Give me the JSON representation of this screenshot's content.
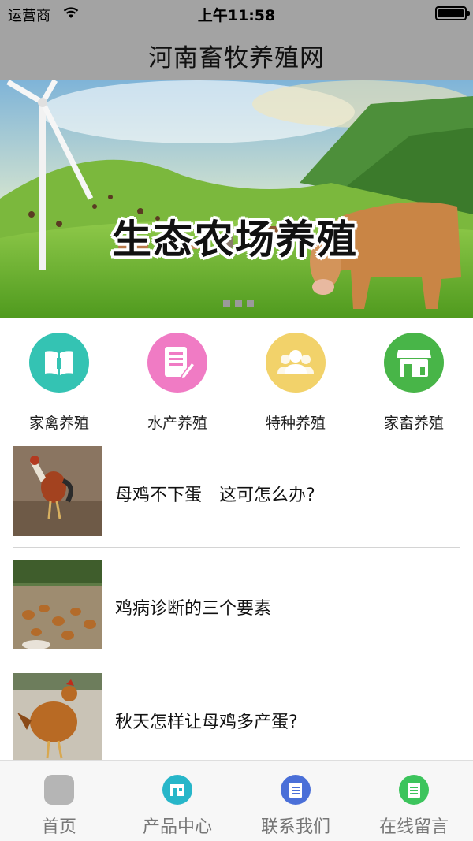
{
  "status_bar": {
    "carrier": "运营商",
    "time": "上午11:58"
  },
  "nav": {
    "title": "河南畜牧养殖网"
  },
  "banner": {
    "headline": "生态农场养殖",
    "page_count": 3,
    "active_page": 1
  },
  "categories": [
    {
      "label": "家禽养殖",
      "icon": "book-icon",
      "color": "#34c3b3"
    },
    {
      "label": "水产养殖",
      "icon": "document-edit-icon",
      "color": "#f07bc4"
    },
    {
      "label": "特种养殖",
      "icon": "people-icon",
      "color": "#f2d26a"
    },
    {
      "label": "家畜养殖",
      "icon": "shop-icon",
      "color": "#48b548"
    }
  ],
  "news": [
    {
      "title": "母鸡不下蛋　这可怎么办?"
    },
    {
      "title": "鸡病诊断的三个要素"
    },
    {
      "title": "秋天怎样让母鸡多产蛋?"
    }
  ],
  "tabs": [
    {
      "label": "首页",
      "icon": "home-icon",
      "color": "#b5b5b5"
    },
    {
      "label": "产品中心",
      "icon": "store-icon",
      "color": "#27b6c9"
    },
    {
      "label": "联系我们",
      "icon": "contact-card-icon",
      "color": "#4a6fd8"
    },
    {
      "label": "在线留言",
      "icon": "message-note-icon",
      "color": "#3cc45c"
    }
  ]
}
